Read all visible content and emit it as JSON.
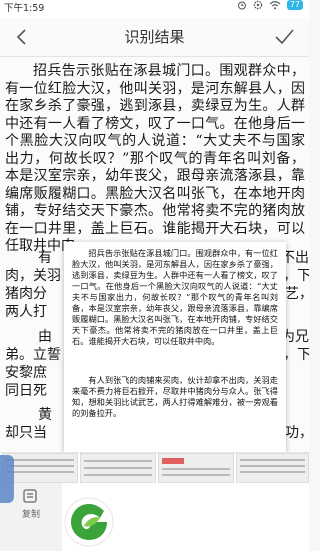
{
  "status_bar": {
    "time": "下午1:59",
    "battery": "77",
    "icons": [
      "alarm-icon",
      "settings-icon",
      "wifi-icon",
      "battery-icon"
    ]
  },
  "header": {
    "title": "识别结果",
    "back_icon": "chevron-left-icon",
    "confirm_icon": "checkmark-icon"
  },
  "document": {
    "paragraph_1": "招兵告示张贴在涿县城门口。围观群众中，有一位红脸大汉，他叫关羽，是河东解县人，因在家乡杀了豪强，逃到涿县，卖绿豆为生。人群中还有一人看了榜文，叹了一口气。在他身后一个黑脸大汉向叹气的人说道：“大丈夫不与国家出力，何故长叹？”那个叹气的青年名叫刘备，本是汉室宗亲，幼年丧父，跟母亲流落涿县，靠编席贩履糊口。黑脸大汉名叫张飞，在本地开肉铺，专好结交天下豪杰。他常将卖不完的猪肉放在一口井里，盖上巨石。谁能揭开大石块，可以任取井中肉。",
    "fragments": [
      {
        "text": "有",
        "row": 1
      },
      {
        "text": "肉，关羽",
        "row": 2
      },
      {
        "text": "猪肉分",
        "row": 3
      },
      {
        "text": "两人打",
        "row": 4
      },
      {
        "text": "由",
        "row": 5
      },
      {
        "text": "弟。立誓",
        "row": 6
      },
      {
        "text": "安黎庶",
        "row": 7
      },
      {
        "text": "同日死",
        "row": 8
      },
      {
        "text": "黄",
        "row": 9
      },
      {
        "text": "却只当",
        "row": 10
      }
    ],
    "right_fragments": [
      "不出",
      "，下",
      "武艺，",
      "为兄",
      "，下",
      "协功，"
    ]
  },
  "popup": {
    "paragraph_1": "招兵告示张贴在涿县城门口。围观群众中，有一位红脸大汉，他叫关羽，是河东解县人，因在家乡杀了豪强，逃到涿县，卖绿豆为生。人群中还有一人看了榜文，叹了一口气。在他身后一个黑脸大汉向叹气的人说道：“大丈夫不与国家出力，何故长叹？”那个叹气的青年名叫刘备，本是汉室宗亲，幼年丧父，跟母亲流落涿县，靠编席贩履糊口。黑脸大汉名叫张飞，在本地开肉铺，专好结交天下豪杰。他常将卖不完的猪肉放在一口井里，盖上巨石。谁能揭开大石块，可以任取井中肉。",
    "paragraph_2": "有人到张飞的肉铺来买肉，伙计却拿不出肉，关羽走来毫不费力将巨石掀开，尽取井中猪肉分与众人。张飞得知，想和关羽比试武艺，两人打得难解难分，被一旁观看的刘备拉开。"
  },
  "bottom": {
    "copy_label": "复制",
    "app_logo": "green-leaf-logo"
  },
  "colors": {
    "battery": "#2fb6e8",
    "logo_green": "#3aa33a",
    "side_handle": "#5b86c4"
  }
}
